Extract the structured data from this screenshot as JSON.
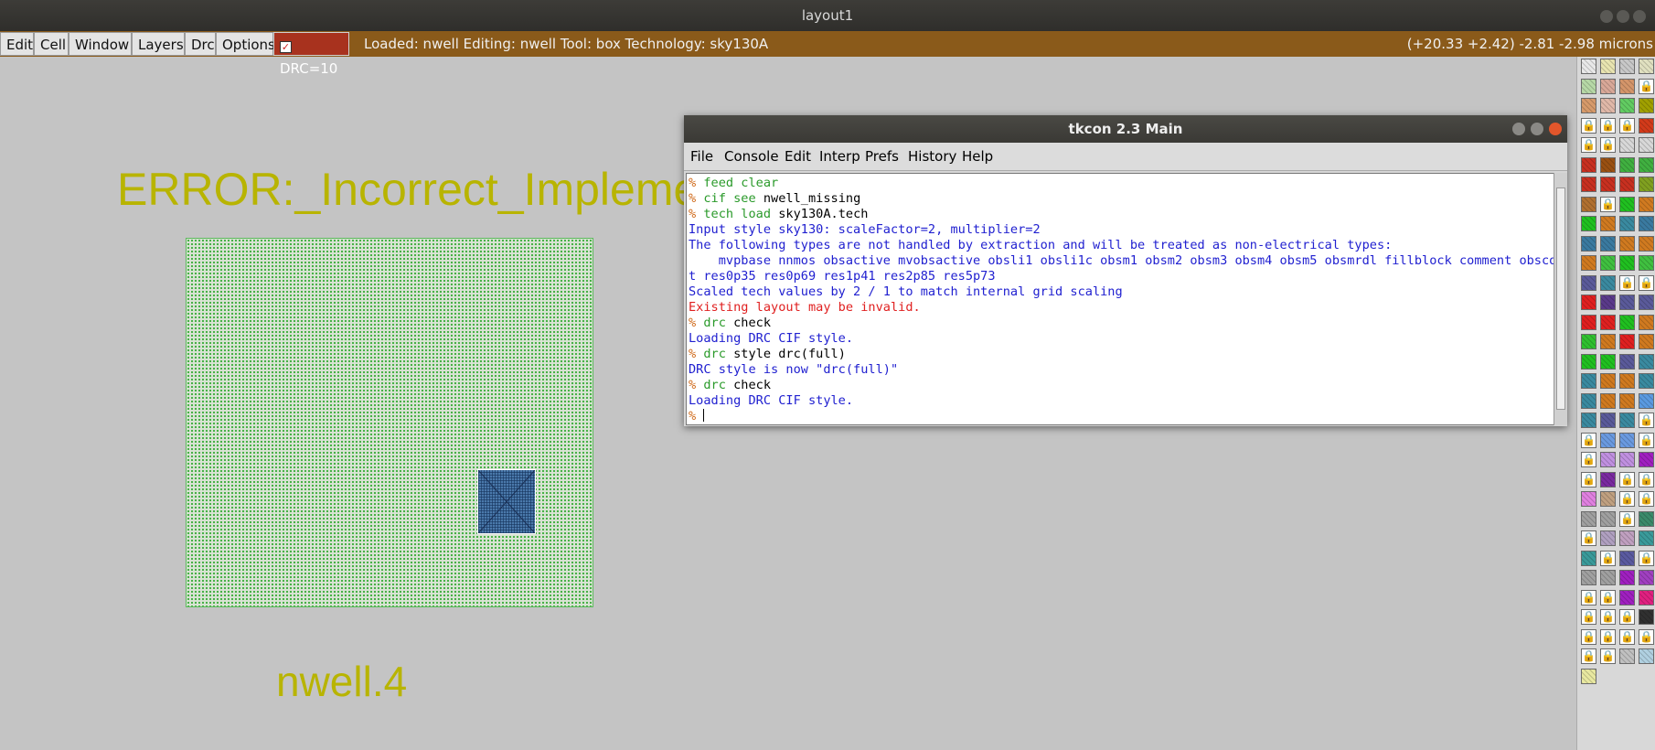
{
  "window": {
    "title": "layout1"
  },
  "menubar": {
    "items": [
      "Edit",
      "Cell",
      "Window",
      "Layers",
      "Drc",
      "Options"
    ],
    "drc_label": "DRC=10",
    "status": "Loaded: nwell Editing: nwell Tool: box  Technology: sky130A",
    "coords": "(+20.33 +2.42) -2.81 -2.98 microns"
  },
  "canvas": {
    "error_label": "ERROR:_Incorrect_Implemer",
    "rule_label": "nwell.4"
  },
  "tkcon": {
    "title": "tkcon 2.3 Main",
    "menu": [
      "File",
      "Console",
      "Edit",
      "Interp",
      "Prefs",
      "History",
      "Help"
    ],
    "lines": [
      {
        "prompt": "% ",
        "cmd": "feed",
        "args": " clear",
        "cmdc": "c",
        "argc": "c"
      },
      {
        "prompt": "% ",
        "cmd": "cif see",
        "args": " nwell_missing",
        "cmdc": "c",
        "argc": "k"
      },
      {
        "prompt": "% ",
        "cmd": "tech load",
        "args": " sky130A.tech",
        "cmdc": "c",
        "argc": "k"
      },
      {
        "text": "Input style sky130: scaleFactor=2, multiplier=2",
        "color": "b"
      },
      {
        "text": "The following types are not handled by extraction and will be treated as non-electrical types:",
        "color": "b"
      },
      {
        "text": "    mvpbase nnmos obsactive mvobsactive obsli1 obsli1c obsm1 obsm2 obsm3 obsm4 obsm5 obsmrdl fillblock comment obscommen",
        "color": "b"
      },
      {
        "text": "t res0p35 res0p69 res1p41 res2p85 res5p73",
        "color": "b"
      },
      {
        "text": "Scaled tech values by 2 / 1 to match internal grid scaling",
        "color": "b"
      },
      {
        "text": "Existing layout may be invalid.",
        "color": "r"
      },
      {
        "prompt": "% ",
        "cmd": "drc",
        "args": " check",
        "cmdc": "c",
        "argc": "k"
      },
      {
        "text": "Loading DRC CIF style.",
        "color": "b"
      },
      {
        "prompt": "% ",
        "cmd": "drc",
        "args": " style drc(full)",
        "cmdc": "c",
        "argc": "k"
      },
      {
        "text": "DRC style is now \"drc(full)\"",
        "color": "b"
      },
      {
        "prompt": "% ",
        "cmd": "drc",
        "args": " check",
        "cmdc": "c",
        "argc": "k"
      },
      {
        "text": "Loading DRC CIF style.",
        "color": "b"
      },
      {
        "prompt": "% ",
        "cmd": "",
        "args": "",
        "cmdc": "c",
        "argc": "k"
      }
    ]
  },
  "palette": {
    "lock_glyph": "🔒",
    "rows": [
      [
        "#e8e8e8",
        "#e8e4b0",
        "#c8c8c8",
        "#e0e0c0"
      ],
      [
        "#b6d8a6",
        "#d8a898",
        "#d4956a",
        "lock"
      ],
      [
        "#d69a6a",
        "#e0b8a8",
        "#62cc62",
        "#a0a000"
      ],
      [
        "lock",
        "lock",
        "lock",
        "#d23a1a"
      ],
      [
        "lock",
        "lock",
        "#d8d8d8",
        "#d8d8d8"
      ],
      [
        "#c83020",
        "#9a5012",
        "#40b040",
        "#40b040"
      ],
      [
        "#c83020",
        "#c83020",
        "#c83020",
        "#80a020"
      ],
      [
        "#b07030",
        "lock",
        "#20c020",
        "#d07a20"
      ],
      [
        "#20c020",
        "#d07a20",
        "#3a8aa0",
        "#3a7aa0"
      ],
      [
        "#3a7aa0",
        "#3a7aa0",
        "#d07a20",
        "#d07a20"
      ],
      [
        "#d07a20",
        "#40c040",
        "#20c020",
        "#40c040"
      ],
      [
        "#5a5a9a",
        "#3a8aa0",
        "lock",
        "lock"
      ],
      [
        "#e02020",
        "#5a3a8a",
        "#5a5a9a",
        "#5a5a9a"
      ],
      [
        "#e02020",
        "#e02020",
        "#20c020",
        "#d07a20"
      ],
      [
        "#30c030",
        "#d07a20",
        "#e02020",
        "#d07a20"
      ],
      [
        "#20c020",
        "#20c020",
        "#5a5a9a",
        "#3a8aa0"
      ],
      [
        "#3a8aa0",
        "#d07a20",
        "#d07a20",
        "#3a8aa0"
      ],
      [
        "#3a8aa0",
        "#d07a20",
        "#d07a20",
        "#5a9ae0"
      ],
      [
        "#3a8aa0",
        "#5a5a9a",
        "#3a8aa0",
        "lock"
      ],
      [
        "lock",
        "#6a9ae0",
        "#6a9ae0",
        "lock"
      ],
      [
        "lock",
        "#c090e0",
        "#c090e0",
        "#a020c0"
      ],
      [
        "lock",
        "#7a2aa0",
        "lock",
        "lock"
      ],
      [
        "#e080e0",
        "#c0a080",
        "lock",
        "lock"
      ],
      [
        "#a0a0a0",
        "#a0a0a0",
        "lock",
        "#3a8a6a"
      ],
      [
        "lock",
        "#b0a0c0",
        "#c0a0c0",
        "#3a9a9a"
      ],
      [
        "#3a9a9a",
        "lock",
        "#5a5aa0",
        "lock"
      ],
      [
        "#a0a0a0",
        "#a0a0a0",
        "#a020c0",
        "#a040c0"
      ],
      [
        "lock",
        "lock",
        "#a020c0",
        "#e02080"
      ],
      [
        "lock",
        "lock",
        "lock",
        "#303030"
      ],
      [
        "lock",
        "lock",
        "lock",
        "lock"
      ],
      [
        "lock",
        "lock",
        "#c0c0c0",
        "#b0d0e0"
      ],
      [
        "#e8e8a0"
      ]
    ]
  }
}
